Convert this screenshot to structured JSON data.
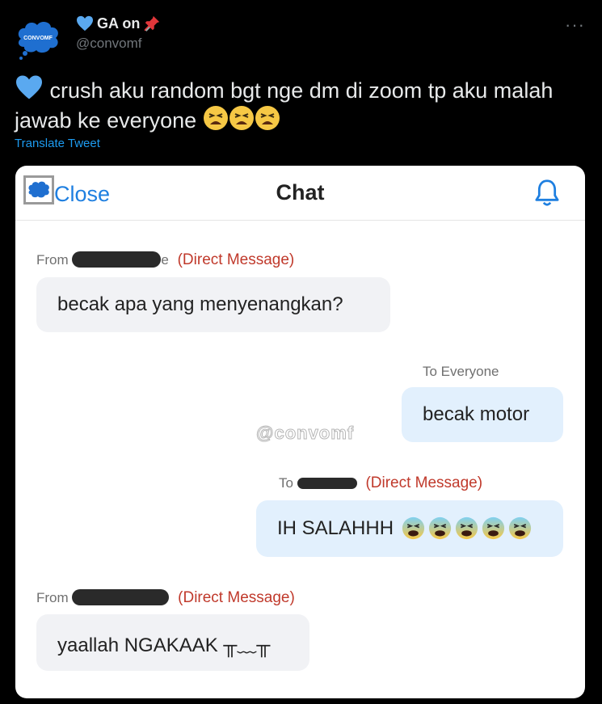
{
  "tweet": {
    "author_name": "GA on",
    "author_handle": "@convomf",
    "avatar_text": "CONVOMF",
    "more_label": "···",
    "text": "crush aku random bgt nge dm di zoom tp aku malah jawab ke everyone",
    "text_icons": [
      "blue-heart-icon",
      "tired-face-icon",
      "tired-face-icon",
      "tired-face-icon"
    ],
    "translate_label": "Translate Tweet",
    "colors": {
      "background": "#000000",
      "link": "#1d9bf0",
      "heart": "#5aa9f0"
    }
  },
  "chat": {
    "close_label": "Close",
    "title": "Chat",
    "bell_icon": "bell-icon",
    "watermark": "@convomf",
    "messages": [
      {
        "meta_prefix": "From",
        "meta_suffix": "e",
        "meta_dm": "(Direct Message)",
        "text": "becak apa yang menyenangkan?"
      },
      {
        "meta_prefix": "To Everyone",
        "text": "becak motor"
      },
      {
        "meta_prefix": "To",
        "meta_dm": "(Direct Message)",
        "text": "IH SALAHHH",
        "emoji": "crying-face-icon x5"
      },
      {
        "meta_prefix": "From",
        "meta_dm": "(Direct Message)",
        "text": "yaallah NGAKAAK ╥﹏╥"
      }
    ],
    "colors": {
      "accent": "#1e7fe0",
      "dm_label": "#c0392b",
      "incoming_bubble": "#f1f2f5",
      "outgoing_bubble": "#e2f0fd"
    }
  }
}
